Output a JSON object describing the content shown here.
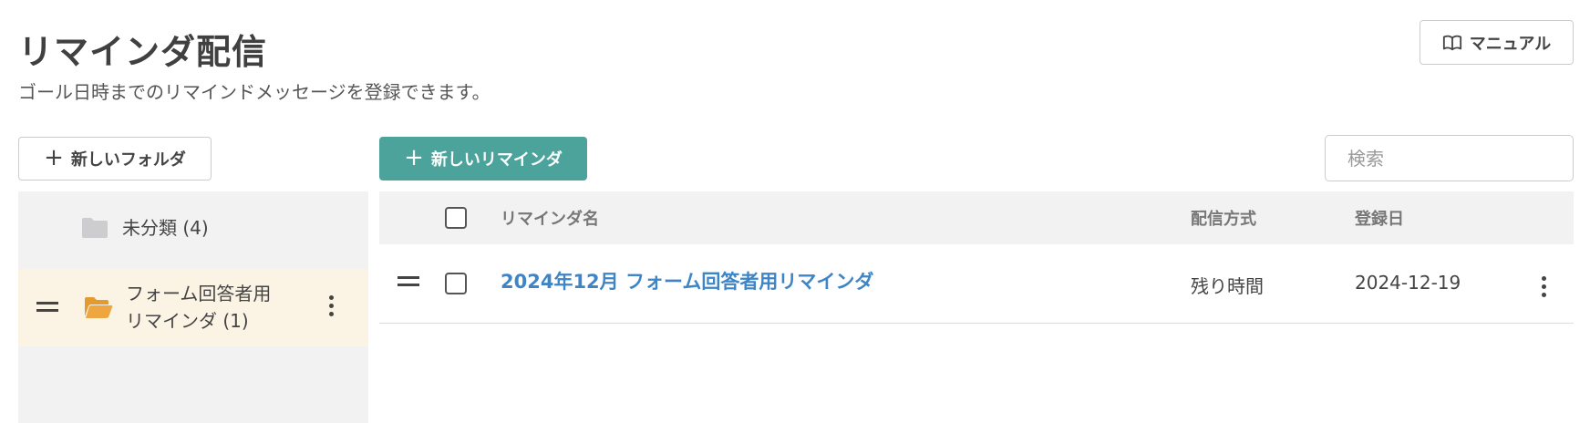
{
  "header": {
    "title": "リマインダ配信",
    "description": "ゴール日時までのリマインドメッセージを登録できます。",
    "manual_label": "マニュアル"
  },
  "toolbar": {
    "new_folder_label": "新しいフォルダ",
    "new_reminder_label": "新しいリマインダ",
    "search_placeholder": "検索",
    "accent_color": "#4ba39b"
  },
  "sidebar": {
    "folders": [
      {
        "label": "未分類 (4)",
        "icon": "folder-icon",
        "selected": false
      },
      {
        "label_line1": "フォーム回答者用",
        "label_line2": "リマインダ (1)",
        "icon": "folder-open-icon",
        "selected": true
      }
    ]
  },
  "table": {
    "columns": [
      "リマインダ名",
      "配信方式",
      "登録日"
    ],
    "rows": [
      {
        "name": "2024年12月 フォーム回答者用リマインダ",
        "method": "残り時間",
        "date": "2024-12-19"
      }
    ]
  }
}
